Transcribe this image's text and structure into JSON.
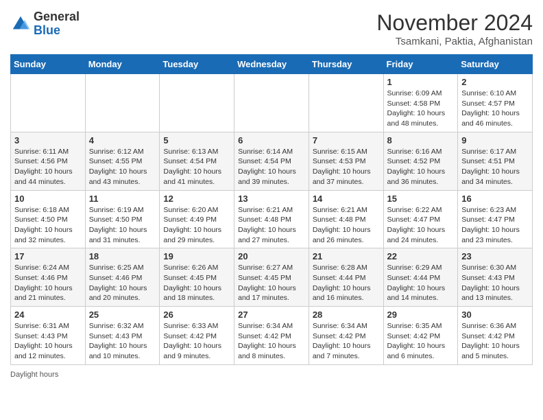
{
  "logo": {
    "general": "General",
    "blue": "Blue"
  },
  "header": {
    "month": "November 2024",
    "location": "Tsamkani, Paktia, Afghanistan"
  },
  "days_of_week": [
    "Sunday",
    "Monday",
    "Tuesday",
    "Wednesday",
    "Thursday",
    "Friday",
    "Saturday"
  ],
  "footer": {
    "daylight_label": "Daylight hours"
  },
  "weeks": [
    [
      {
        "day": "",
        "info": ""
      },
      {
        "day": "",
        "info": ""
      },
      {
        "day": "",
        "info": ""
      },
      {
        "day": "",
        "info": ""
      },
      {
        "day": "",
        "info": ""
      },
      {
        "day": "1",
        "info": "Sunrise: 6:09 AM\nSunset: 4:58 PM\nDaylight: 10 hours and 48 minutes."
      },
      {
        "day": "2",
        "info": "Sunrise: 6:10 AM\nSunset: 4:57 PM\nDaylight: 10 hours and 46 minutes."
      }
    ],
    [
      {
        "day": "3",
        "info": "Sunrise: 6:11 AM\nSunset: 4:56 PM\nDaylight: 10 hours and 44 minutes."
      },
      {
        "day": "4",
        "info": "Sunrise: 6:12 AM\nSunset: 4:55 PM\nDaylight: 10 hours and 43 minutes."
      },
      {
        "day": "5",
        "info": "Sunrise: 6:13 AM\nSunset: 4:54 PM\nDaylight: 10 hours and 41 minutes."
      },
      {
        "day": "6",
        "info": "Sunrise: 6:14 AM\nSunset: 4:54 PM\nDaylight: 10 hours and 39 minutes."
      },
      {
        "day": "7",
        "info": "Sunrise: 6:15 AM\nSunset: 4:53 PM\nDaylight: 10 hours and 37 minutes."
      },
      {
        "day": "8",
        "info": "Sunrise: 6:16 AM\nSunset: 4:52 PM\nDaylight: 10 hours and 36 minutes."
      },
      {
        "day": "9",
        "info": "Sunrise: 6:17 AM\nSunset: 4:51 PM\nDaylight: 10 hours and 34 minutes."
      }
    ],
    [
      {
        "day": "10",
        "info": "Sunrise: 6:18 AM\nSunset: 4:50 PM\nDaylight: 10 hours and 32 minutes."
      },
      {
        "day": "11",
        "info": "Sunrise: 6:19 AM\nSunset: 4:50 PM\nDaylight: 10 hours and 31 minutes."
      },
      {
        "day": "12",
        "info": "Sunrise: 6:20 AM\nSunset: 4:49 PM\nDaylight: 10 hours and 29 minutes."
      },
      {
        "day": "13",
        "info": "Sunrise: 6:21 AM\nSunset: 4:48 PM\nDaylight: 10 hours and 27 minutes."
      },
      {
        "day": "14",
        "info": "Sunrise: 6:21 AM\nSunset: 4:48 PM\nDaylight: 10 hours and 26 minutes."
      },
      {
        "day": "15",
        "info": "Sunrise: 6:22 AM\nSunset: 4:47 PM\nDaylight: 10 hours and 24 minutes."
      },
      {
        "day": "16",
        "info": "Sunrise: 6:23 AM\nSunset: 4:47 PM\nDaylight: 10 hours and 23 minutes."
      }
    ],
    [
      {
        "day": "17",
        "info": "Sunrise: 6:24 AM\nSunset: 4:46 PM\nDaylight: 10 hours and 21 minutes."
      },
      {
        "day": "18",
        "info": "Sunrise: 6:25 AM\nSunset: 4:46 PM\nDaylight: 10 hours and 20 minutes."
      },
      {
        "day": "19",
        "info": "Sunrise: 6:26 AM\nSunset: 4:45 PM\nDaylight: 10 hours and 18 minutes."
      },
      {
        "day": "20",
        "info": "Sunrise: 6:27 AM\nSunset: 4:45 PM\nDaylight: 10 hours and 17 minutes."
      },
      {
        "day": "21",
        "info": "Sunrise: 6:28 AM\nSunset: 4:44 PM\nDaylight: 10 hours and 16 minutes."
      },
      {
        "day": "22",
        "info": "Sunrise: 6:29 AM\nSunset: 4:44 PM\nDaylight: 10 hours and 14 minutes."
      },
      {
        "day": "23",
        "info": "Sunrise: 6:30 AM\nSunset: 4:43 PM\nDaylight: 10 hours and 13 minutes."
      }
    ],
    [
      {
        "day": "24",
        "info": "Sunrise: 6:31 AM\nSunset: 4:43 PM\nDaylight: 10 hours and 12 minutes."
      },
      {
        "day": "25",
        "info": "Sunrise: 6:32 AM\nSunset: 4:43 PM\nDaylight: 10 hours and 10 minutes."
      },
      {
        "day": "26",
        "info": "Sunrise: 6:33 AM\nSunset: 4:42 PM\nDaylight: 10 hours and 9 minutes."
      },
      {
        "day": "27",
        "info": "Sunrise: 6:34 AM\nSunset: 4:42 PM\nDaylight: 10 hours and 8 minutes."
      },
      {
        "day": "28",
        "info": "Sunrise: 6:34 AM\nSunset: 4:42 PM\nDaylight: 10 hours and 7 minutes."
      },
      {
        "day": "29",
        "info": "Sunrise: 6:35 AM\nSunset: 4:42 PM\nDaylight: 10 hours and 6 minutes."
      },
      {
        "day": "30",
        "info": "Sunrise: 6:36 AM\nSunset: 4:42 PM\nDaylight: 10 hours and 5 minutes."
      }
    ]
  ]
}
